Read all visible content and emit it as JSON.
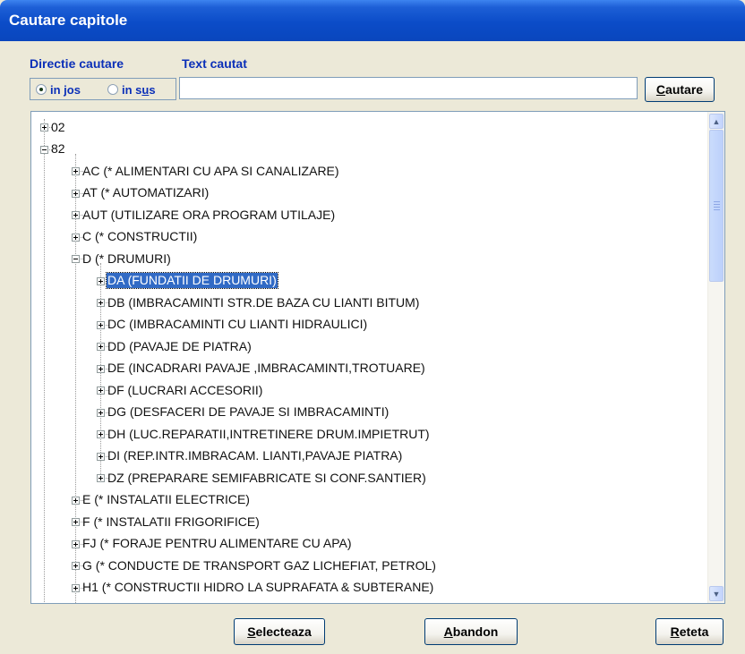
{
  "window": {
    "title": "Cautare capitole"
  },
  "search": {
    "direction_label": "Directie cautare",
    "text_label": "Text cautat",
    "options": [
      {
        "label_pre": "in jos",
        "label_u": "",
        "label_post": "",
        "selected": true
      },
      {
        "label_pre": "in s",
        "label_u": "u",
        "label_post": "s",
        "selected": false
      }
    ],
    "text_value": "",
    "button": {
      "u": "C",
      "rest": "autare"
    }
  },
  "tree": {
    "nodes": [
      {
        "label": "02",
        "level": 0,
        "expanded": false
      },
      {
        "label": "82",
        "level": 0,
        "expanded": true
      },
      {
        "label": "AC (* ALIMENTARI CU APA SI CANALIZARE)",
        "level": 1,
        "expanded": false
      },
      {
        "label": "AT (* AUTOMATIZARI)",
        "level": 1,
        "expanded": false
      },
      {
        "label": "AUT (UTILIZARE ORA PROGRAM UTILAJE)",
        "level": 1,
        "expanded": false
      },
      {
        "label": "C (* CONSTRUCTII)",
        "level": 1,
        "expanded": false
      },
      {
        "label": "D (* DRUMURI)",
        "level": 1,
        "expanded": true
      },
      {
        "label": "DA (FUNDATII DE DRUMURI)",
        "level": 2,
        "expanded": false,
        "selected": true
      },
      {
        "label": "DB (IMBRACAMINTI STR.DE BAZA CU LIANTI BITUM)",
        "level": 2,
        "expanded": false
      },
      {
        "label": "DC (IMBRACAMINTI CU LIANTI HIDRAULICI)",
        "level": 2,
        "expanded": false
      },
      {
        "label": "DD (PAVAJE DE PIATRA)",
        "level": 2,
        "expanded": false
      },
      {
        "label": "DE (INCADRARI PAVAJE ,IMBRACAMINTI,TROTUARE)",
        "level": 2,
        "expanded": false
      },
      {
        "label": "DF (LUCRARI ACCESORII)",
        "level": 2,
        "expanded": false
      },
      {
        "label": "DG (DESFACERI DE PAVAJE SI IMBRACAMINTI)",
        "level": 2,
        "expanded": false
      },
      {
        "label": "DH (LUC.REPARATII,INTRETINERE DRUM.IMPIETRUT)",
        "level": 2,
        "expanded": false
      },
      {
        "label": "DI (REP.INTR.IMBRACAM. LIANTI,PAVAJE PIATRA)",
        "level": 2,
        "expanded": false
      },
      {
        "label": "DZ (PREPARARE SEMIFABRICATE SI CONF.SANTIER)",
        "level": 2,
        "expanded": false
      },
      {
        "label": "E (* INSTALATII ELECTRICE)",
        "level": 1,
        "expanded": false
      },
      {
        "label": "F (* INSTALATII FRIGORIFICE)",
        "level": 1,
        "expanded": false
      },
      {
        "label": "FJ (* FORAJE PENTRU ALIMENTARE CU APA)",
        "level": 1,
        "expanded": false
      },
      {
        "label": "G (* CONDUCTE DE TRANSPORT GAZ LICHEFIAT, PETROL)",
        "level": 1,
        "expanded": false
      },
      {
        "label": "H1 (* CONSTRUCTII HIDRO LA SUPRAFATA & SUBTERANE)",
        "level": 1,
        "expanded": false
      }
    ]
  },
  "footer": {
    "buttons": [
      {
        "u": "S",
        "rest": "electeaza"
      },
      {
        "u": "A",
        "rest": "bandon"
      },
      {
        "u": "R",
        "rest": "eteta"
      }
    ]
  },
  "icons": {
    "scroll_up": "scroll-up-arrow-icon",
    "scroll_down": "scroll-down-arrow-icon",
    "expand": "plus-box-icon",
    "collapse": "minus-box-icon"
  },
  "colors": {
    "title_bar": "#0a46bd",
    "selection": "#316ac5",
    "label_text": "#0a2fb8",
    "window_bg": "#ece9d8"
  }
}
